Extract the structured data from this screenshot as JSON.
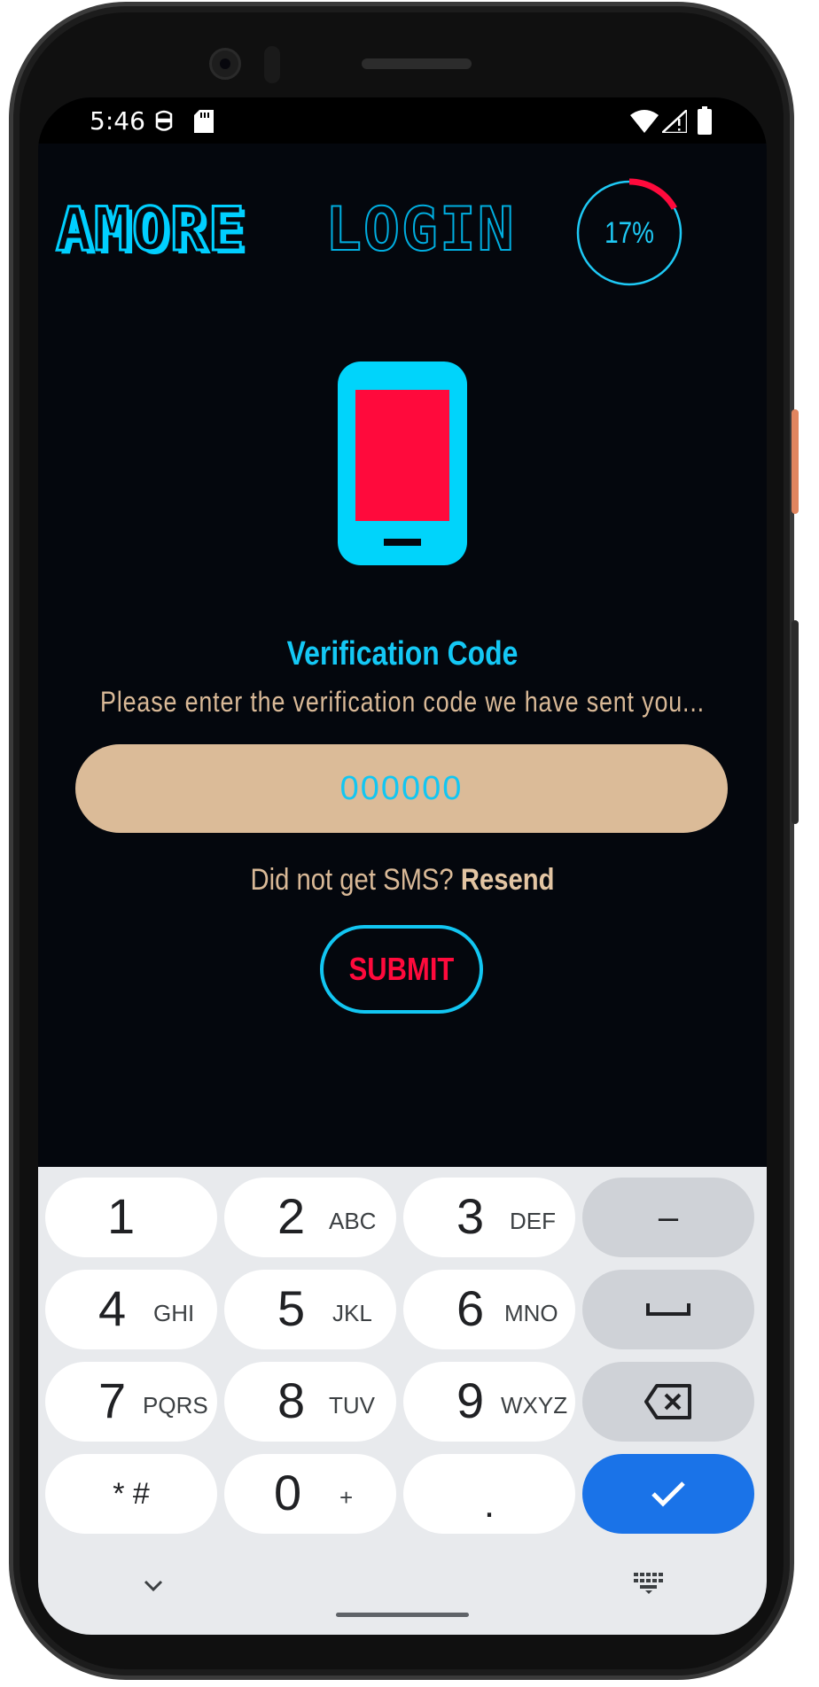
{
  "status_bar": {
    "time": "5:46",
    "left_icons": [
      "notification-face-icon",
      "sd-card-icon"
    ],
    "right_icons": [
      "wifi-icon",
      "cellular-signal-icon",
      "battery-icon"
    ]
  },
  "header": {
    "title_part1": "AMORE",
    "title_part2": "LOGIN",
    "progress": {
      "value": 0.17,
      "label": "17%",
      "track_color": "#1ec9f5",
      "fill_color": "#ff0a3c"
    }
  },
  "illustration": {
    "icon": "smartphone-icon",
    "body_color": "#00d4fb",
    "screen_color": "#ff0a3c"
  },
  "verification": {
    "heading": "Verification Code",
    "subtitle": "Please enter the verification code we have sent you...",
    "code_placeholder": "000000",
    "code_value": "",
    "resend_prompt": "Did not get SMS?",
    "resend_link": "Resend",
    "submit_label": "SUBMIT"
  },
  "keyboard": {
    "keys": [
      {
        "digit": "1",
        "letters": ""
      },
      {
        "digit": "2",
        "letters": "ABC"
      },
      {
        "digit": "3",
        "letters": "DEF"
      },
      {
        "symbol": "–"
      },
      {
        "digit": "4",
        "letters": "GHI"
      },
      {
        "digit": "5",
        "letters": "JKL"
      },
      {
        "digit": "6",
        "letters": "MNO"
      },
      {
        "symbol": "space-icon"
      },
      {
        "digit": "7",
        "letters": "PQRS"
      },
      {
        "digit": "8",
        "letters": "TUV"
      },
      {
        "digit": "9",
        "letters": "WXYZ"
      },
      {
        "symbol": "backspace-icon"
      },
      {
        "label": "* #"
      },
      {
        "digit": "0",
        "letters": "+"
      },
      {
        "label": "."
      },
      {
        "symbol": "check-icon"
      }
    ],
    "bottom_icons": [
      "chevron-down-icon",
      "keyboard-icon"
    ],
    "accent": "#1a73e8"
  },
  "colors": {
    "background": "#04070d",
    "accent_cyan": "#12c6f2",
    "accent_red": "#ff0a3c",
    "sand": "#dbbb98"
  }
}
